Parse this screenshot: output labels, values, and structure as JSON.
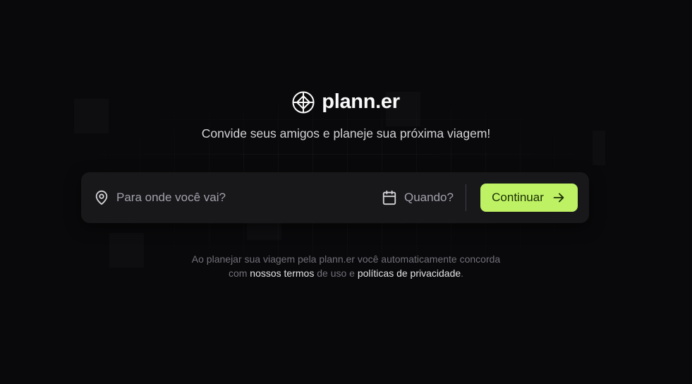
{
  "colors": {
    "background": "#09090b",
    "surface": "#18181b",
    "accent": "#bef264",
    "accent_text": "#1a2e05",
    "muted_text": "#a1a1aa",
    "legal_text": "#71717a"
  },
  "brand": {
    "logo_icon": "globe-compass-icon",
    "name": "plann.er"
  },
  "tagline": "Convide seus amigos e planeje sua próxima viagem!",
  "search": {
    "destination_icon": "map-pin-icon",
    "destination_placeholder": "Para onde você vai?",
    "destination_value": "",
    "date_icon": "calendar-icon",
    "date_label": "Quando?",
    "continue_label": "Continuar",
    "continue_icon": "arrow-right-icon"
  },
  "legal": {
    "line1": "Ao planejar sua viagem pela plann.er você automaticamente concorda",
    "prefix": "com",
    "terms_link": "nossos termos",
    "middle": "de uso e",
    "privacy_link": "políticas de privacidade",
    "suffix": "."
  }
}
